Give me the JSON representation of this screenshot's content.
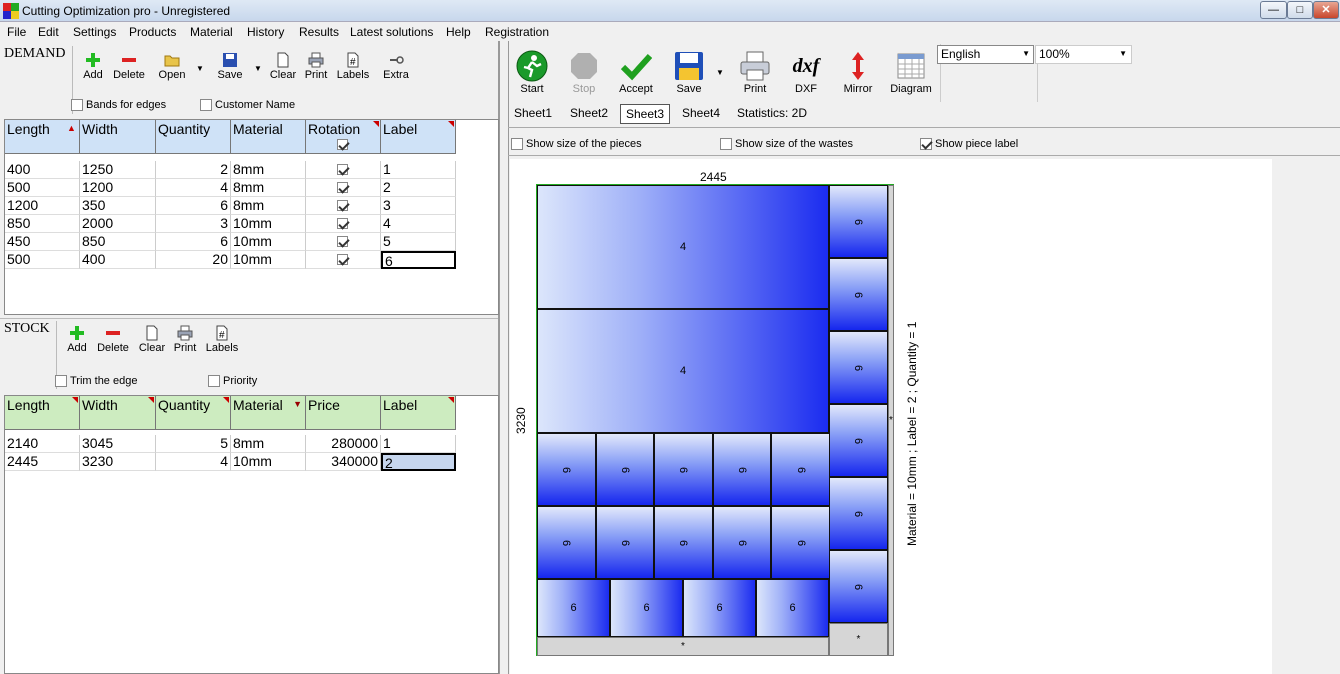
{
  "window": {
    "title": "Cutting Optimization pro - Unregistered",
    "min_label": "—",
    "max_label": "□",
    "close_label": "✕"
  },
  "menu": [
    "File",
    "Edit",
    "Settings",
    "Products",
    "Material",
    "History",
    "Results",
    "Latest solutions",
    "Help",
    "Registration"
  ],
  "demand": {
    "section_label": "DEMAND",
    "toolbar": {
      "add": "Add",
      "delete": "Delete",
      "open": "Open",
      "save": "Save",
      "clear": "Clear",
      "print": "Print",
      "labels": "Labels",
      "extra": "Extra"
    },
    "options": {
      "bands_for_edges": "Bands for edges",
      "customer_name": "Customer Name"
    },
    "columns": [
      "Length",
      "Width",
      "Quantity",
      "Material",
      "Rotation",
      "Label"
    ],
    "rows": [
      {
        "length": "400",
        "width": "1250",
        "quantity": "2",
        "material": "8mm",
        "rotation": true,
        "label": "1"
      },
      {
        "length": "500",
        "width": "1200",
        "quantity": "4",
        "material": "8mm",
        "rotation": true,
        "label": "2"
      },
      {
        "length": "1200",
        "width": "350",
        "quantity": "6",
        "material": "8mm",
        "rotation": true,
        "label": "3"
      },
      {
        "length": "850",
        "width": "2000",
        "quantity": "3",
        "material": "10mm",
        "rotation": true,
        "label": "4"
      },
      {
        "length": "450",
        "width": "850",
        "quantity": "6",
        "material": "10mm",
        "rotation": true,
        "label": "5"
      },
      {
        "length": "500",
        "width": "400",
        "quantity": "20",
        "material": "10mm",
        "rotation": true,
        "label": "6"
      }
    ]
  },
  "stock": {
    "section_label": "STOCK",
    "toolbar": {
      "add": "Add",
      "delete": "Delete",
      "clear": "Clear",
      "print": "Print",
      "labels": "Labels"
    },
    "options": {
      "trim_the_edge": "Trim the edge",
      "priority": "Priority"
    },
    "columns": [
      "Length",
      "Width",
      "Quantity",
      "Material",
      "Price",
      "Label"
    ],
    "rows": [
      {
        "length": "2140",
        "width": "3045",
        "quantity": "5",
        "material": "8mm",
        "price": "280000",
        "label": "1"
      },
      {
        "length": "2445",
        "width": "3230",
        "quantity": "4",
        "material": "10mm",
        "price": "340000",
        "label": "2"
      }
    ]
  },
  "results_toolbar": {
    "start": "Start",
    "stop": "Stop",
    "accept": "Accept",
    "save": "Save",
    "print": "Print",
    "dxf": "DXF",
    "dxf_icon": "dxf",
    "mirror": "Mirror",
    "diagram": "Diagram"
  },
  "language": "English",
  "zoom": "100%",
  "tabs": [
    "Sheet1",
    "Sheet2",
    "Sheet3",
    "Sheet4",
    "Statistics: 2D"
  ],
  "active_tab": "Sheet3",
  "view_options": {
    "show_size_pieces": {
      "label": "Show size of the pieces",
      "checked": false
    },
    "show_size_wastes": {
      "label": "Show size of the wastes",
      "checked": false
    },
    "show_piece_label": {
      "label": "Show piece label",
      "checked": true
    }
  },
  "sheet": {
    "width_label": "2445",
    "height_label": "3230",
    "info_label": "Material = 10mm ; Label = 2 ; Quantity = 1",
    "large_piece_label": "4",
    "small_piece_label": "6",
    "waste_label": "*"
  },
  "colors": {
    "piece_dark": "#1b2cf0",
    "piece_light": "#dce6fb",
    "demand_header": "#cfe2f7",
    "stock_header": "#cdecc0"
  }
}
